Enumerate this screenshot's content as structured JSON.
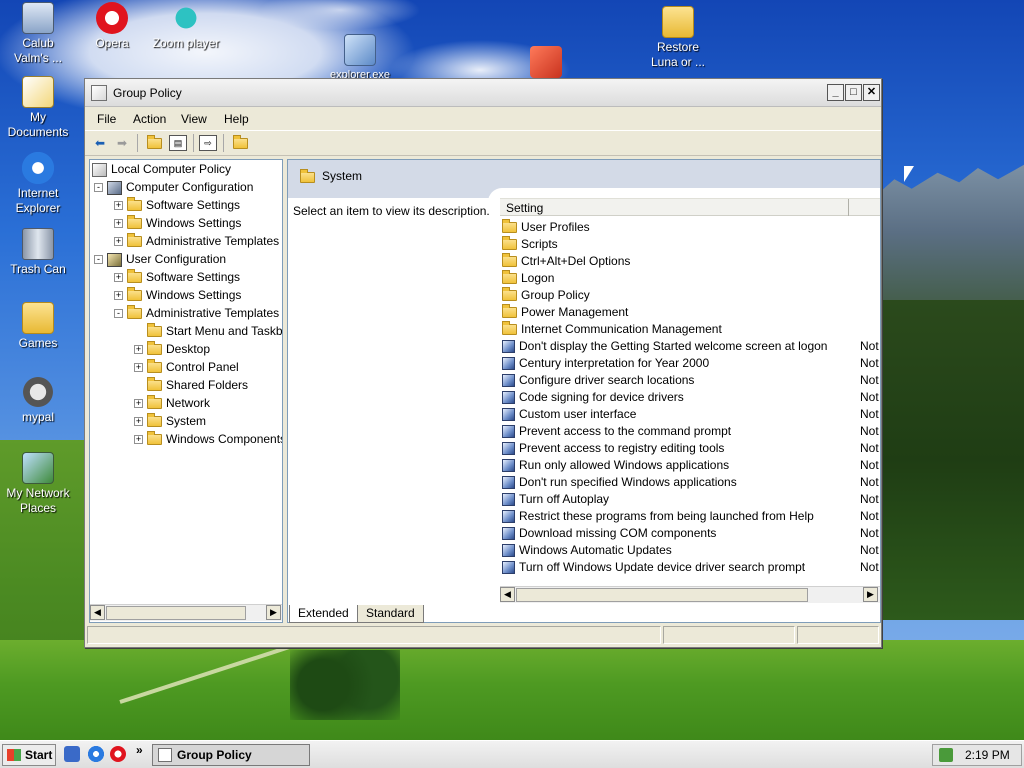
{
  "desktop": {
    "icons": [
      {
        "label": "Calub\nValm's ...",
        "icon": "computer-icon"
      },
      {
        "label": "Opera",
        "icon": "opera-icon"
      },
      {
        "label": "Zoom player",
        "icon": "zoom-player-icon"
      },
      {
        "label": "explorer.exe",
        "icon": "network-globe-icon"
      },
      {
        "label": "",
        "icon": "app-icon"
      },
      {
        "label": "Restore\nLuna or ...",
        "icon": "folder-icon"
      },
      {
        "label": "My\nDocuments",
        "icon": "documents-icon"
      },
      {
        "label": "Internet\nExplorer",
        "icon": "ie-icon"
      },
      {
        "label": "Trash Can",
        "icon": "trash-icon"
      },
      {
        "label": "Games",
        "icon": "folder-icon"
      },
      {
        "label": "mypal",
        "icon": "mypal-icon"
      },
      {
        "label": "My Network\nPlaces",
        "icon": "network-icon"
      }
    ]
  },
  "window": {
    "title": "Group Policy",
    "controls": {
      "minimize": "_",
      "maximize": "□",
      "close": "✕"
    },
    "menu": [
      "File",
      "Action",
      "View",
      "Help"
    ],
    "toolbar": [
      "back-arrow-icon",
      "forward-arrow-icon",
      "up-folder-icon",
      "show-hide-tree-icon",
      "export-list-icon",
      "help-icon"
    ],
    "tree": {
      "root": "Local Computer Policy",
      "nodes": [
        {
          "label": "Computer Configuration",
          "level": 1,
          "expander": "-",
          "icon": "computer-config-icon"
        },
        {
          "label": "Software Settings",
          "level": 2,
          "expander": "+",
          "icon": "folder-icon"
        },
        {
          "label": "Windows Settings",
          "level": 2,
          "expander": "+",
          "icon": "folder-icon"
        },
        {
          "label": "Administrative Templates",
          "level": 2,
          "expander": "+",
          "icon": "folder-icon"
        },
        {
          "label": "User Configuration",
          "level": 1,
          "expander": "-",
          "icon": "user-config-icon"
        },
        {
          "label": "Software Settings",
          "level": 2,
          "expander": "+",
          "icon": "folder-icon"
        },
        {
          "label": "Windows Settings",
          "level": 2,
          "expander": "+",
          "icon": "folder-icon"
        },
        {
          "label": "Administrative Templates",
          "level": 2,
          "expander": "-",
          "icon": "folder-icon"
        },
        {
          "label": "Start Menu and Taskbar",
          "level": 3,
          "expander": "",
          "icon": "folder-icon"
        },
        {
          "label": "Desktop",
          "level": 3,
          "expander": "+",
          "icon": "folder-icon"
        },
        {
          "label": "Control Panel",
          "level": 3,
          "expander": "+",
          "icon": "folder-icon"
        },
        {
          "label": "Shared Folders",
          "level": 3,
          "expander": "",
          "icon": "folder-icon"
        },
        {
          "label": "Network",
          "level": 3,
          "expander": "+",
          "icon": "folder-icon"
        },
        {
          "label": "System",
          "level": 3,
          "expander": "+",
          "icon": "folder-icon"
        },
        {
          "label": "Windows Components",
          "level": 3,
          "expander": "+",
          "icon": "folder-icon"
        }
      ]
    },
    "right": {
      "header": "System",
      "description": "Select an item to view its description.",
      "column_setting": "Setting",
      "items": [
        {
          "name": "User Profiles",
          "type": "folder",
          "state": ""
        },
        {
          "name": "Scripts",
          "type": "folder",
          "state": ""
        },
        {
          "name": "Ctrl+Alt+Del Options",
          "type": "folder",
          "state": ""
        },
        {
          "name": "Logon",
          "type": "folder",
          "state": ""
        },
        {
          "name": "Group Policy",
          "type": "folder",
          "state": ""
        },
        {
          "name": "Power Management",
          "type": "folder",
          "state": ""
        },
        {
          "name": "Internet Communication Management",
          "type": "folder",
          "state": ""
        },
        {
          "name": "Don't display the Getting Started welcome screen at logon",
          "type": "policy",
          "state": "Not"
        },
        {
          "name": "Century interpretation for Year 2000",
          "type": "policy",
          "state": "Not"
        },
        {
          "name": "Configure driver search locations",
          "type": "policy",
          "state": "Not"
        },
        {
          "name": "Code signing for device drivers",
          "type": "policy",
          "state": "Not"
        },
        {
          "name": "Custom user interface",
          "type": "policy",
          "state": "Not"
        },
        {
          "name": "Prevent access to the command prompt",
          "type": "policy",
          "state": "Not"
        },
        {
          "name": "Prevent access to registry editing tools",
          "type": "policy",
          "state": "Not"
        },
        {
          "name": "Run only allowed Windows applications",
          "type": "policy",
          "state": "Not"
        },
        {
          "name": "Don't run specified Windows applications",
          "type": "policy",
          "state": "Not"
        },
        {
          "name": "Turn off Autoplay",
          "type": "policy",
          "state": "Not"
        },
        {
          "name": "Restrict these programs from being launched from Help",
          "type": "policy",
          "state": "Not"
        },
        {
          "name": "Download missing COM components",
          "type": "policy",
          "state": "Not"
        },
        {
          "name": "Windows Automatic Updates",
          "type": "policy",
          "state": "Not"
        },
        {
          "name": "Turn off Windows Update device driver search prompt",
          "type": "policy",
          "state": "Not"
        }
      ]
    },
    "tabs": [
      "Extended",
      "Standard"
    ]
  },
  "taskbar": {
    "start_label": "Start",
    "chevron": "»",
    "task_label": "Group Policy",
    "clock": "2:19 PM"
  }
}
